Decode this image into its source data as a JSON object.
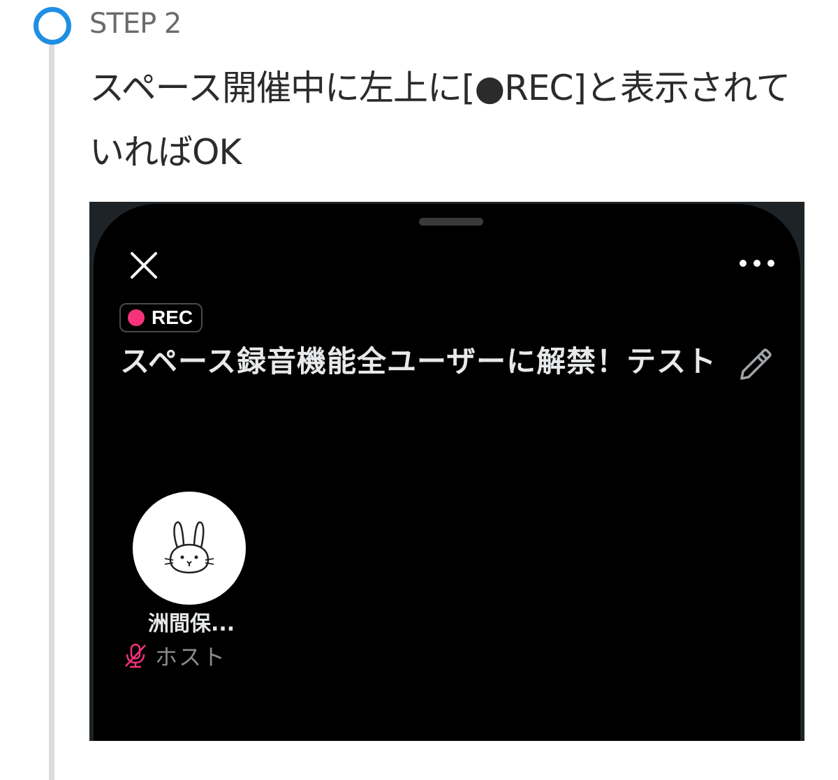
{
  "step": {
    "label": "STEP 2",
    "description": "スペース開催中に左上に[●REC]と表示されていればOK"
  },
  "colors": {
    "step_circle": "#1f8ee3",
    "timeline": "#dcdcdc",
    "rec_dot": "#f4337a",
    "muted_mic": "#f4337a"
  },
  "space": {
    "rec_label": "REC",
    "title": "スペース録音機能全ユーザーに解禁！テスト",
    "speaker": {
      "name": "洲間保...",
      "role": "ホスト",
      "avatar": "rabbit-doodle"
    },
    "icons": {
      "close": "close-icon",
      "more": "more-icon",
      "edit": "pencil-icon",
      "mic": "mic-off-icon"
    }
  }
}
